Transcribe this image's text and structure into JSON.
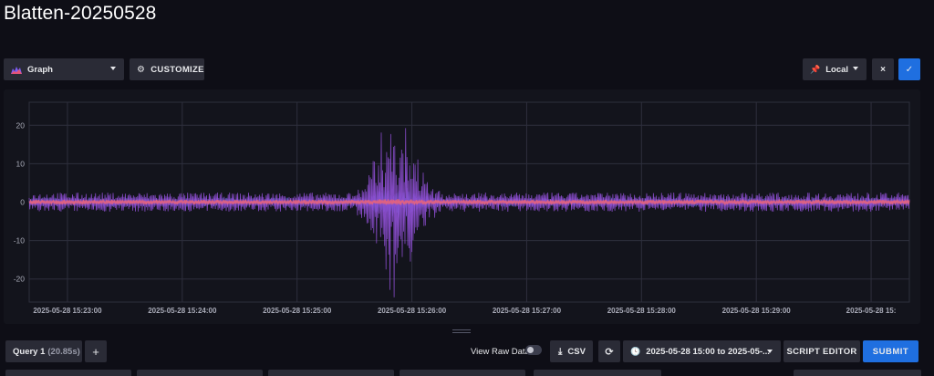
{
  "page_title": "Blatten-20250528",
  "toolbar": {
    "view_type": "Graph",
    "customize_label": "CUSTOMIZE",
    "timezone": "Local",
    "cancel_label": "×",
    "confirm_label": "✓"
  },
  "chart_data": {
    "type": "line",
    "y_ticks": [
      "20",
      "10",
      "0",
      "-10",
      "-20"
    ],
    "x_ticks": [
      "2025-05-28 15:23:00",
      "2025-05-28 15:24:00",
      "2025-05-28 15:25:00",
      "2025-05-28 15:26:00",
      "2025-05-28 15:27:00",
      "2025-05-28 15:28:00",
      "2025-05-28 15:29:00",
      "2025-05-28 15:"
    ],
    "ylim": [
      -26,
      26
    ],
    "xlim": [
      "2025-05-28 15:22:40",
      "2025-05-28 15:30:20"
    ],
    "grid": true,
    "series": [
      {
        "color": "#8f4fd4",
        "description": "large oscillating trace",
        "baseline_amplitude": 2.5,
        "event_peak": 26,
        "event_center": "2025-05-28 15:25:50",
        "event_start": "2025-05-28 15:25:30",
        "event_end": "2025-05-28 15:26:15"
      },
      {
        "color": "#e8647a",
        "description": "near-zero trace",
        "baseline_amplitude": 0.6
      },
      {
        "color": "#5e6bd6",
        "description": "small oscillating trace",
        "baseline_amplitude": 1.2
      }
    ]
  },
  "query": {
    "tab_label": "Query 1",
    "tab_duration": "(20.85s)",
    "add_label": "+"
  },
  "controls": {
    "view_raw_label": "View Raw Data",
    "csv_label": "CSV",
    "time_range": "2025-05-28 15:00 to 2025-05-...",
    "script_editor_label": "SCRIPT EDITOR",
    "submit_label": "SUBMIT"
  },
  "colors": {
    "accent": "#1f6fe0",
    "background": "#0e0e16",
    "panel": "#13141c"
  }
}
